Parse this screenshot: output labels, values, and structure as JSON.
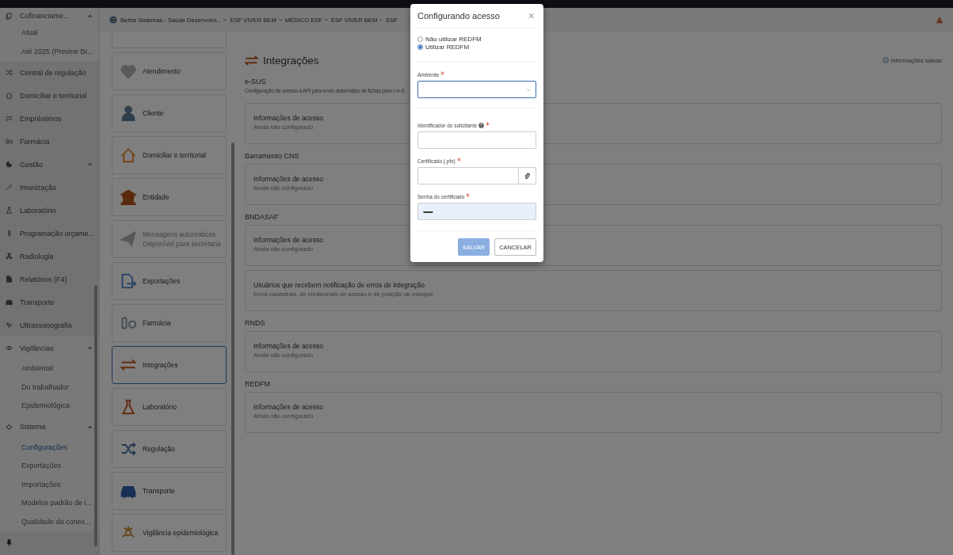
{
  "sidebar": {
    "items": [
      {
        "label": "Cofinanciame...",
        "expanded": true,
        "children": [
          {
            "label": "Atual",
            "selected": false
          },
          {
            "label": "Até 2025 (Previne Br...",
            "selected": false
          }
        ]
      },
      {
        "label": "Central de regulação"
      },
      {
        "label": "Domiciliar e territorial"
      },
      {
        "label": "Empréstimos"
      },
      {
        "label": "Farmácia"
      },
      {
        "label": "Gestão",
        "expanded": false
      },
      {
        "label": "Imunização"
      },
      {
        "label": "Laboratório"
      },
      {
        "label": "Programação orçame..."
      },
      {
        "label": "Radiologia"
      },
      {
        "label": "Relatórios (F4)"
      },
      {
        "label": "Transporte"
      },
      {
        "label": "Ultrassonografia"
      },
      {
        "label": "Vigilâncias",
        "expanded": true,
        "children": [
          {
            "label": "Ambiental",
            "selected": false
          },
          {
            "label": "Do trabalhador",
            "selected": false
          },
          {
            "label": "Epidemiológica",
            "selected": false
          }
        ]
      },
      {
        "label": "Sistema",
        "expanded": true,
        "children": [
          {
            "label": "Configurações",
            "selected": true
          },
          {
            "label": "Exportações",
            "selected": false
          },
          {
            "label": "Importações",
            "selected": false
          },
          {
            "label": "Modelos padrão de i...",
            "selected": false
          },
          {
            "label": "Qualidade da conex...",
            "selected": false
          }
        ]
      }
    ]
  },
  "breadcrumb": {
    "organization": "Betha Sistemas - Saúde Desenvolvi...",
    "items": [
      "ESF VIVER BEM",
      "MÉDICO ESF",
      "ESF VIVER BEM",
      "ESF"
    ]
  },
  "settings_menu": [
    {
      "label": "Atendimento",
      "selected": false,
      "disabled": false
    },
    {
      "label": "Cliente",
      "selected": false,
      "disabled": false
    },
    {
      "label": "Domiciliar e territorial",
      "selected": false,
      "disabled": false
    },
    {
      "label": "Entidade",
      "selected": false,
      "disabled": false
    },
    {
      "label": "Mensagens automáticas",
      "note": "Disponível para secretaria",
      "selected": false,
      "disabled": true
    },
    {
      "label": "Exportações",
      "selected": false,
      "disabled": false
    },
    {
      "label": "Farmácia",
      "selected": false,
      "disabled": false
    },
    {
      "label": "Integrações",
      "selected": true,
      "disabled": false
    },
    {
      "label": "Laboratório",
      "selected": false,
      "disabled": false
    },
    {
      "label": "Regulação",
      "selected": false,
      "disabled": false
    },
    {
      "label": "Transporte",
      "selected": false,
      "disabled": false
    },
    {
      "label": "Vigilância epidemiológica",
      "selected": false,
      "disabled": false
    }
  ],
  "page": {
    "title": "Integrações",
    "save_status": "Informações salvas",
    "sections": [
      {
        "title": "e-SUS",
        "description": "Configuração de acesso a API para envio automático de fichas para o e-S",
        "cards": [
          {
            "title": "Informações de acesso",
            "subtitle": "Ainda não configurado"
          }
        ]
      },
      {
        "title": "Barramento CNS",
        "cards": [
          {
            "title": "Informações de acesso",
            "subtitle": "Ainda não configurado"
          }
        ]
      },
      {
        "title": "BNDASAF",
        "cards": [
          {
            "title": "Informações de acesso",
            "subtitle": "Ainda não configurado"
          },
          {
            "title": "Usuários que recebem notificação de erros de integração",
            "subtitle": "Erros cadastrais, de credenciais de acesso e de posição de estoque"
          }
        ]
      },
      {
        "title": "RNDS",
        "cards": [
          {
            "title": "Informações de acesso",
            "subtitle": "Ainda não configurado"
          }
        ]
      },
      {
        "title": "REDFM",
        "cards": [
          {
            "title": "Informações de acesso",
            "subtitle": "Ainda não configurado"
          }
        ]
      }
    ]
  },
  "dialog": {
    "title": "Configurando acesso",
    "close": "×",
    "options": [
      {
        "label": "Não utilizar REDFM",
        "selected": false
      },
      {
        "label": "Utilizar REDFM",
        "selected": true
      }
    ],
    "fields": [
      {
        "kind": "select",
        "label": "Ambiente",
        "required": true,
        "focused": true
      },
      {
        "kind": "text",
        "label": "Identificador do solicitante",
        "help": true,
        "required": true,
        "focused": false
      },
      {
        "kind": "file",
        "label": "Certificado (.pfx)",
        "required": true,
        "focused": false
      },
      {
        "kind": "password",
        "label": "Senha do certificado",
        "required": true,
        "focused": false,
        "value": "••••••••"
      }
    ],
    "buttons": [
      {
        "label": "SALVAR",
        "kind": "primary"
      },
      {
        "label": "CANCELAR",
        "kind": "secondary"
      }
    ]
  }
}
